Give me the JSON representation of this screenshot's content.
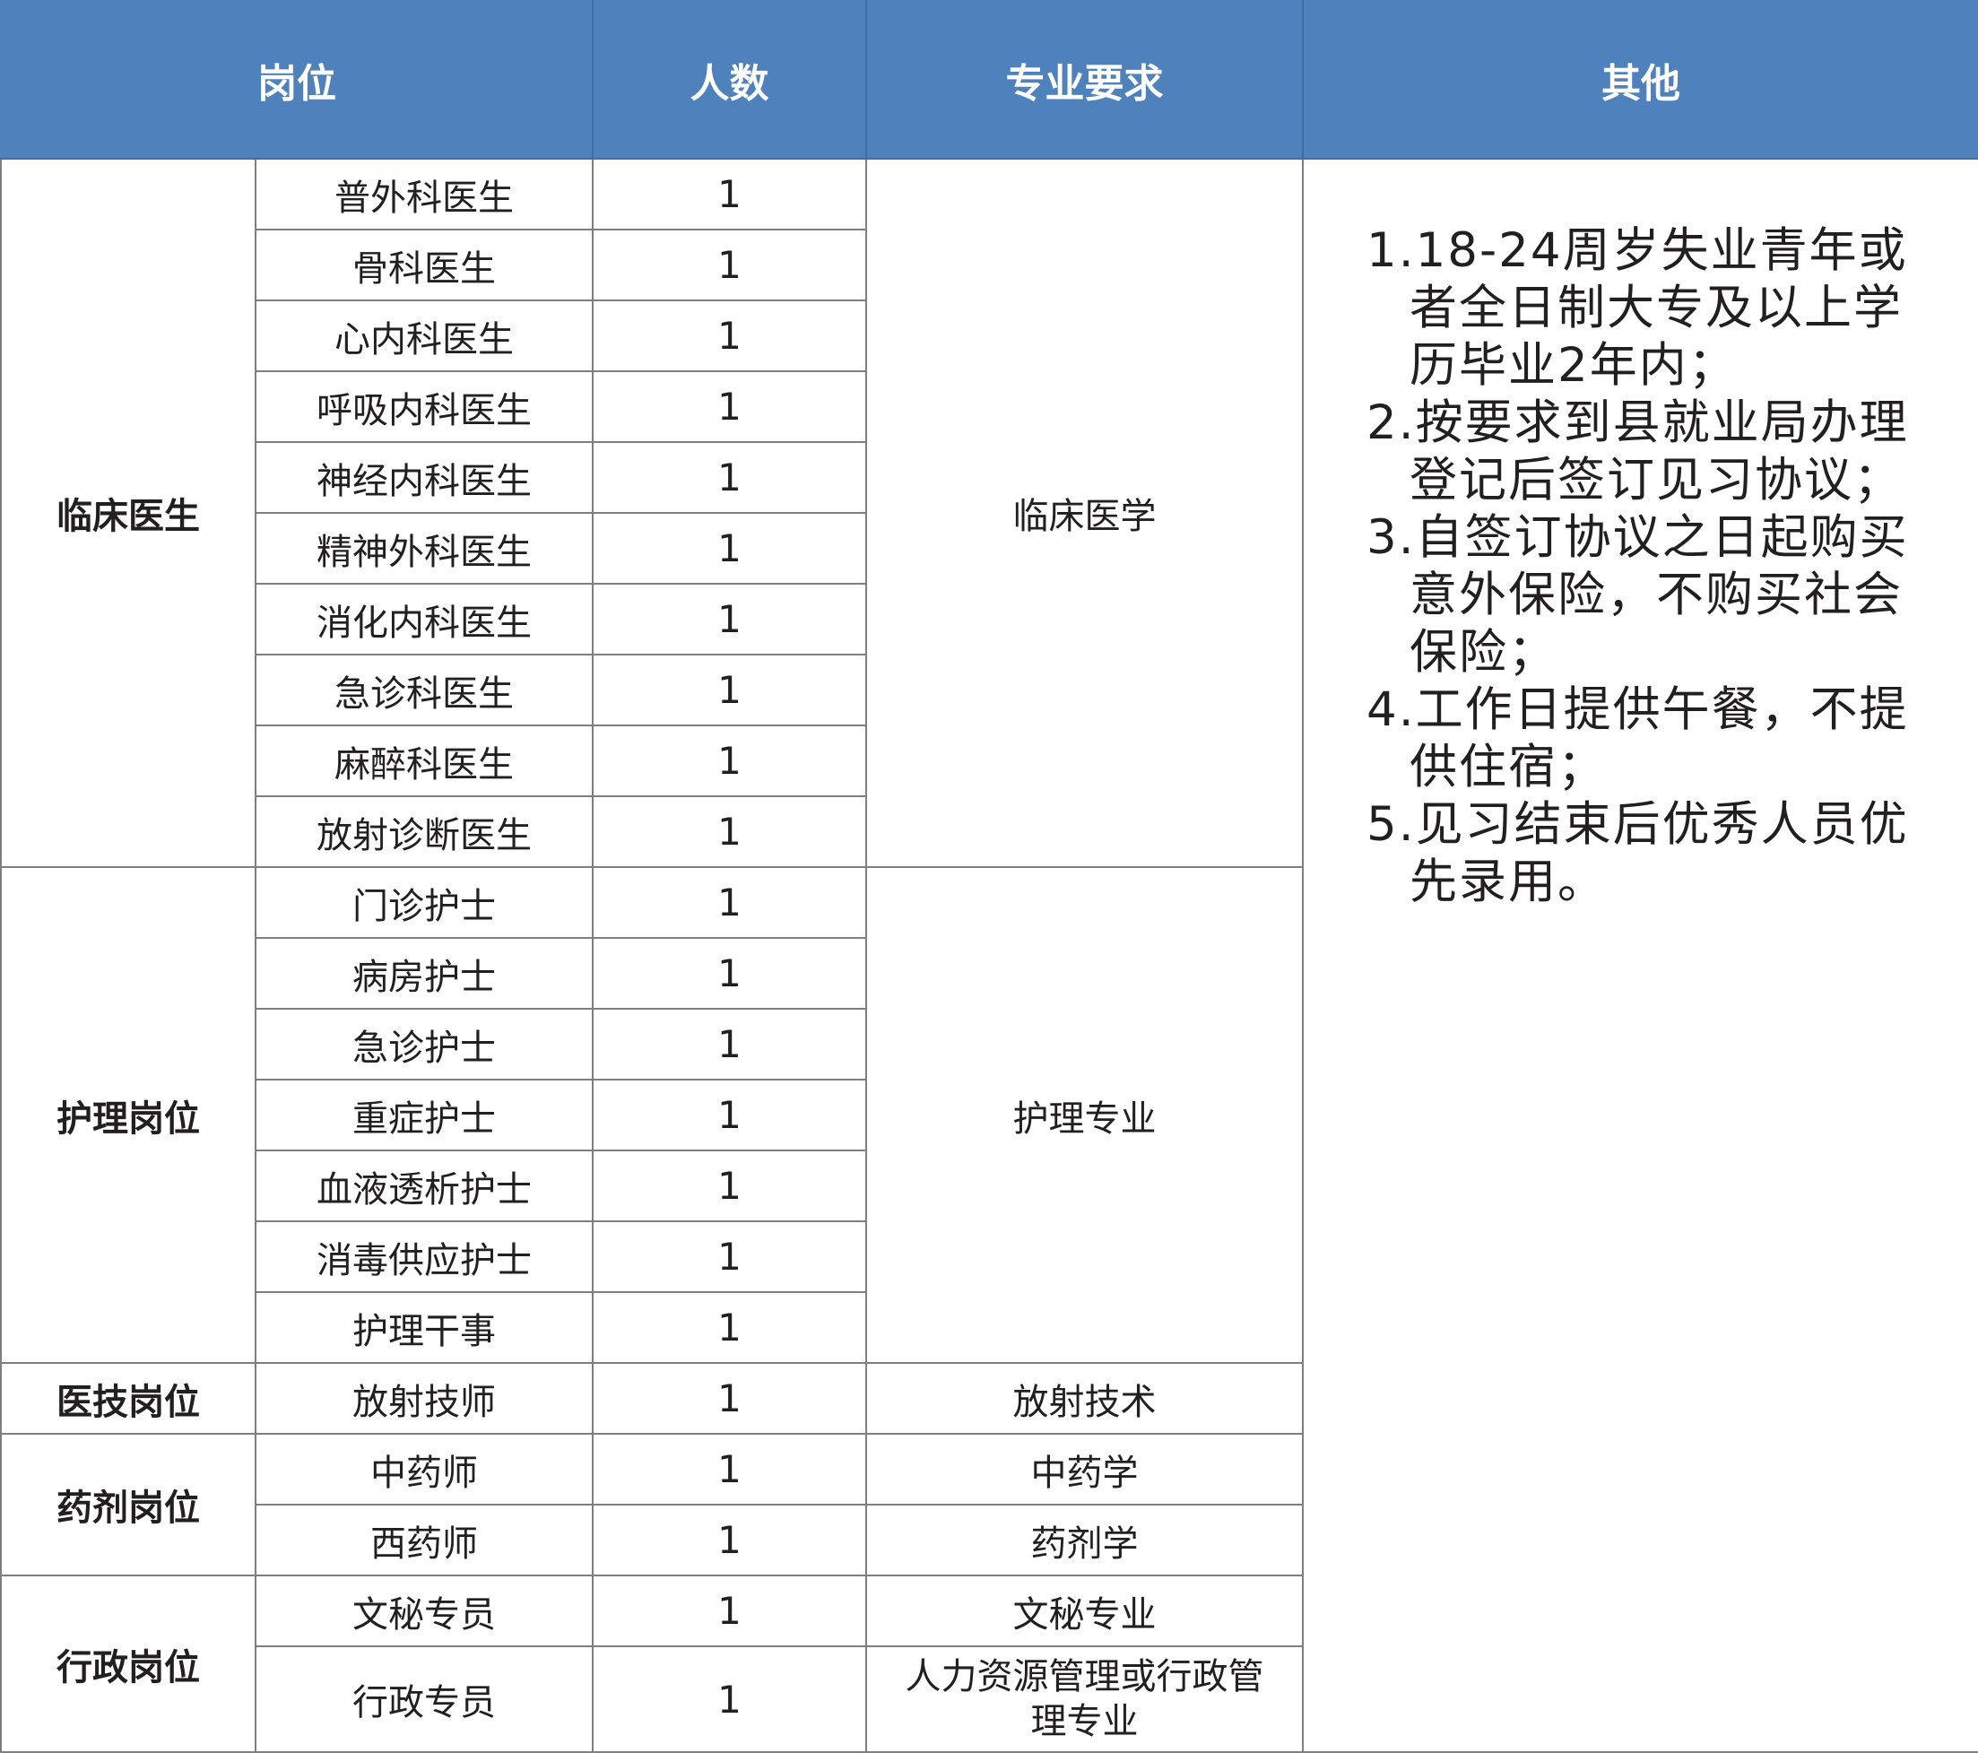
{
  "headers": {
    "position": "岗位",
    "count": "人数",
    "major": "专业要求",
    "other": "其他"
  },
  "groups": [
    {
      "category": "临床医生",
      "major": "临床医学",
      "rows": [
        {
          "post": "普外科医生",
          "count": "1"
        },
        {
          "post": "骨科医生",
          "count": "1"
        },
        {
          "post": "心内科医生",
          "count": "1"
        },
        {
          "post": "呼吸内科医生",
          "count": "1"
        },
        {
          "post": "神经内科医生",
          "count": "1"
        },
        {
          "post": "精神外科医生",
          "count": "1"
        },
        {
          "post": "消化内科医生",
          "count": "1"
        },
        {
          "post": "急诊科医生",
          "count": "1"
        },
        {
          "post": "麻醉科医生",
          "count": "1"
        },
        {
          "post": "放射诊断医生",
          "count": "1"
        }
      ]
    },
    {
      "category": "护理岗位",
      "major": "护理专业",
      "rows": [
        {
          "post": "门诊护士",
          "count": "1"
        },
        {
          "post": "病房护士",
          "count": "1"
        },
        {
          "post": "急诊护士",
          "count": "1"
        },
        {
          "post": "重症护士",
          "count": "1"
        },
        {
          "post": "血液透析护士",
          "count": "1"
        },
        {
          "post": "消毒供应护士",
          "count": "1"
        },
        {
          "post": "护理干事",
          "count": "1"
        }
      ]
    },
    {
      "category": "医技岗位",
      "rows": [
        {
          "post": "放射技师",
          "count": "1",
          "major": "放射技术"
        }
      ]
    },
    {
      "category": "药剂岗位",
      "rows": [
        {
          "post": "中药师",
          "count": "1",
          "major": "中药学"
        },
        {
          "post": "西药师",
          "count": "1",
          "major": "药剂学"
        }
      ]
    },
    {
      "category": "行政岗位",
      "rows": [
        {
          "post": "文秘专员",
          "count": "1",
          "major": "文秘专业"
        },
        {
          "post": "行政专员",
          "count": "1",
          "major": "人力资源管理或行政管理专业"
        }
      ]
    }
  ],
  "notes": [
    "1.18-24周岁失业青年或者全日制大专及以上学历毕业2年内；",
    "2.按要求到县就业局办理登记后签订见习协议；",
    "3.自签订协议之日起购买意外保险，不购买社会保险；",
    "4.工作日提供午餐，不提供住宿；",
    "5.见习结束后优秀人员优先录用。"
  ],
  "colors": {
    "header_bg": "#4f81bd",
    "header_text": "#ffffff",
    "border": "#7f7f7f",
    "text": "#231f20"
  }
}
